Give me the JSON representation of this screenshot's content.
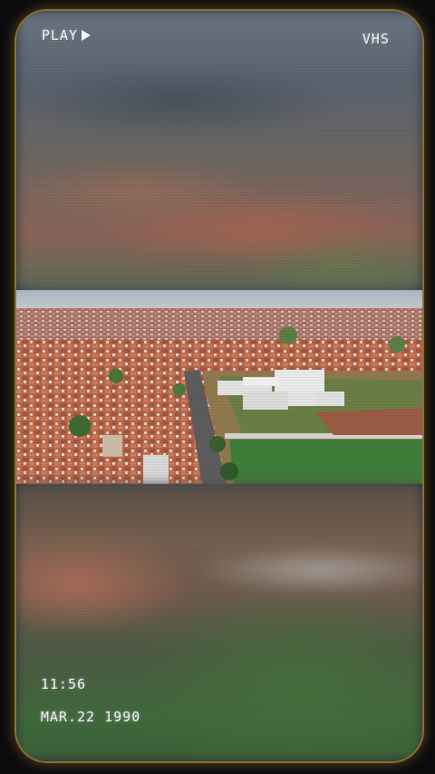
{
  "overlay": {
    "play_label": "PLAY",
    "play_icon": "play-triangle-icon",
    "format_label": "VHS",
    "time": "11:56",
    "date": "MAR.22 1990"
  },
  "colors": {
    "frame_glow": "#d6aa50",
    "osd_text": "#f2f2f2",
    "background": "#0b0b0d"
  }
}
